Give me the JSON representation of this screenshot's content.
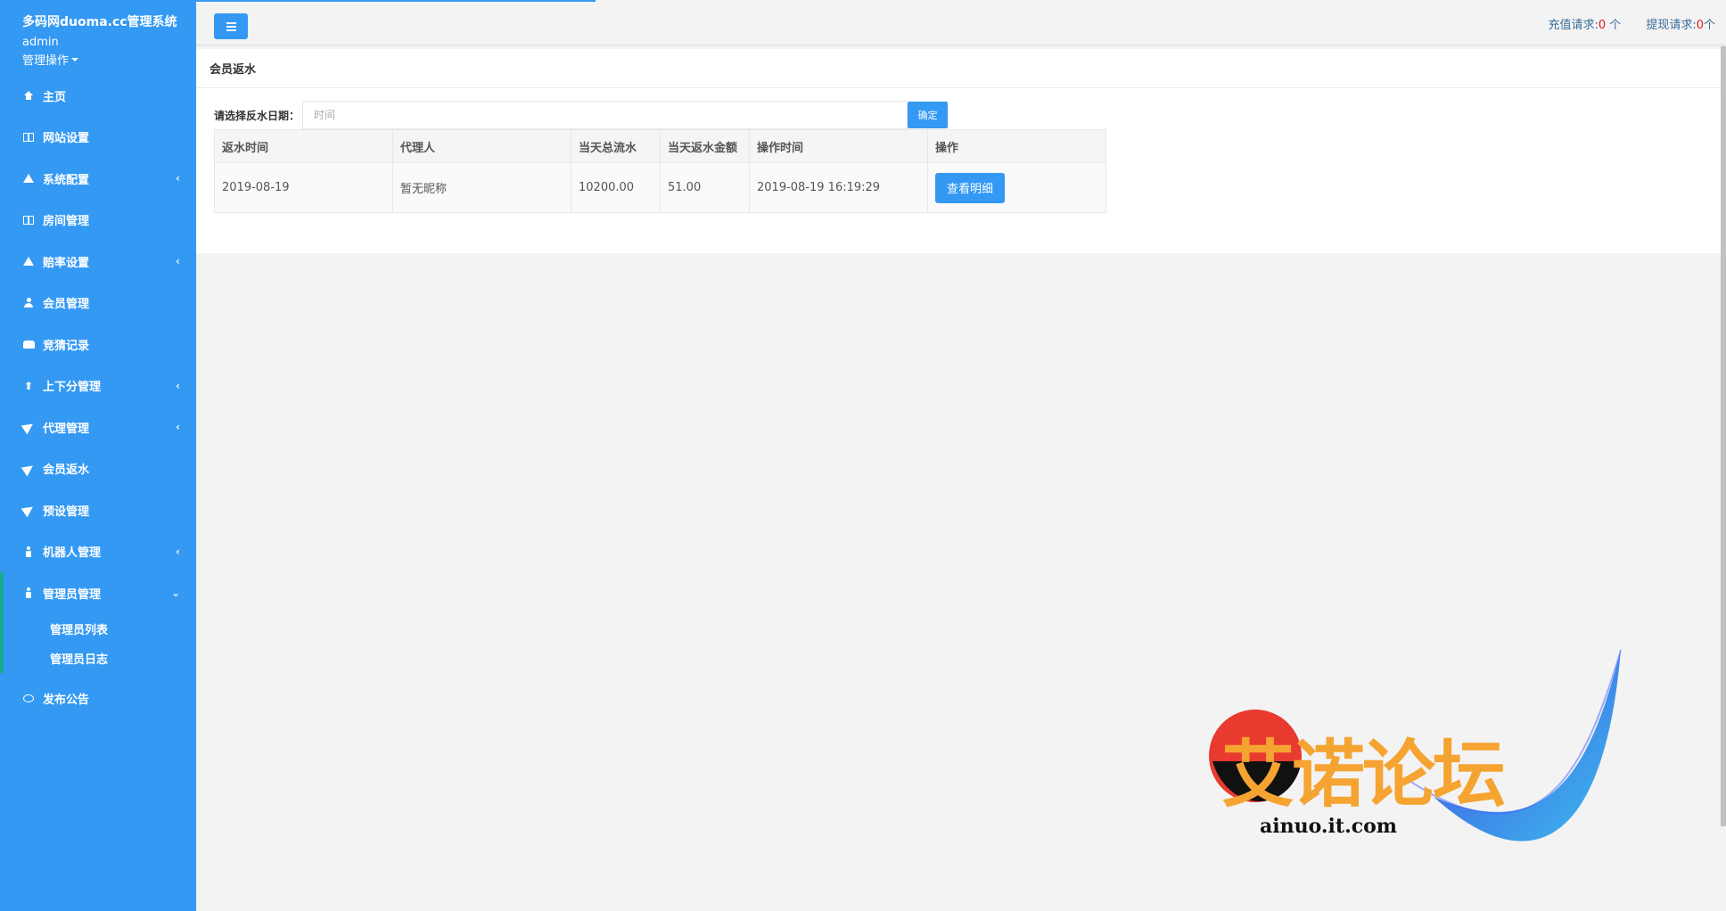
{
  "sidebar": {
    "brand": "多码网duoma.cc管理系统",
    "user": "admin",
    "user_menu": "管理操作",
    "items": [
      {
        "label": "主页",
        "icon": "home-icon",
        "has_arrow": false
      },
      {
        "label": "网站设置",
        "icon": "columns-icon",
        "has_arrow": false
      },
      {
        "label": "系统配置",
        "icon": "flask-icon",
        "has_arrow": true
      },
      {
        "label": "房间管理",
        "icon": "columns-icon",
        "has_arrow": false
      },
      {
        "label": "赔率设置",
        "icon": "flask-icon",
        "has_arrow": true
      },
      {
        "label": "会员管理",
        "icon": "user-icon",
        "has_arrow": false
      },
      {
        "label": "竞猜记录",
        "icon": "car-icon",
        "has_arrow": false
      },
      {
        "label": "上下分管理",
        "icon": "arrow-up-icon",
        "has_arrow": true
      },
      {
        "label": "代理管理",
        "icon": "paper-plane-icon",
        "has_arrow": true
      },
      {
        "label": "会员返水",
        "icon": "paper-plane-icon",
        "has_arrow": false
      },
      {
        "label": "预设管理",
        "icon": "paper-plane-icon",
        "has_arrow": false
      },
      {
        "label": "机器人管理",
        "icon": "person-icon",
        "has_arrow": true
      },
      {
        "label": "管理员管理",
        "icon": "person-icon",
        "has_arrow": true,
        "expanded": true
      }
    ],
    "sub_items": [
      "管理员列表",
      "管理员日志"
    ],
    "last_item": {
      "label": "发布公告",
      "icon": "comment-icon"
    }
  },
  "topbar": {
    "recharge_label": "充值请求:",
    "recharge_count": "0",
    "recharge_unit": "个",
    "withdraw_label": "提现请求:",
    "withdraw_count": "0",
    "withdraw_unit": "个"
  },
  "panel": {
    "title": "会员返水",
    "filter_label": "请选择反水日期：",
    "date_placeholder": "时间",
    "confirm_label": "确定"
  },
  "table": {
    "headers": [
      "返水时间",
      "代理人",
      "当天总流水",
      "当天返水金额",
      "操作时间",
      "操作"
    ],
    "rows": [
      {
        "date": "2019-08-19",
        "agent": "暂无昵称",
        "turnover": "10200.00",
        "rebate": "51.00",
        "op_time": "2019-08-19 16:19:29",
        "action": "查看明细"
      }
    ]
  },
  "watermark": {
    "title": "艾诺论坛",
    "site": "ainuo.it.com"
  },
  "colors": {
    "primary": "#3399f3",
    "accent_green": "#19aa8d",
    "count_red": "#e01b1b"
  }
}
